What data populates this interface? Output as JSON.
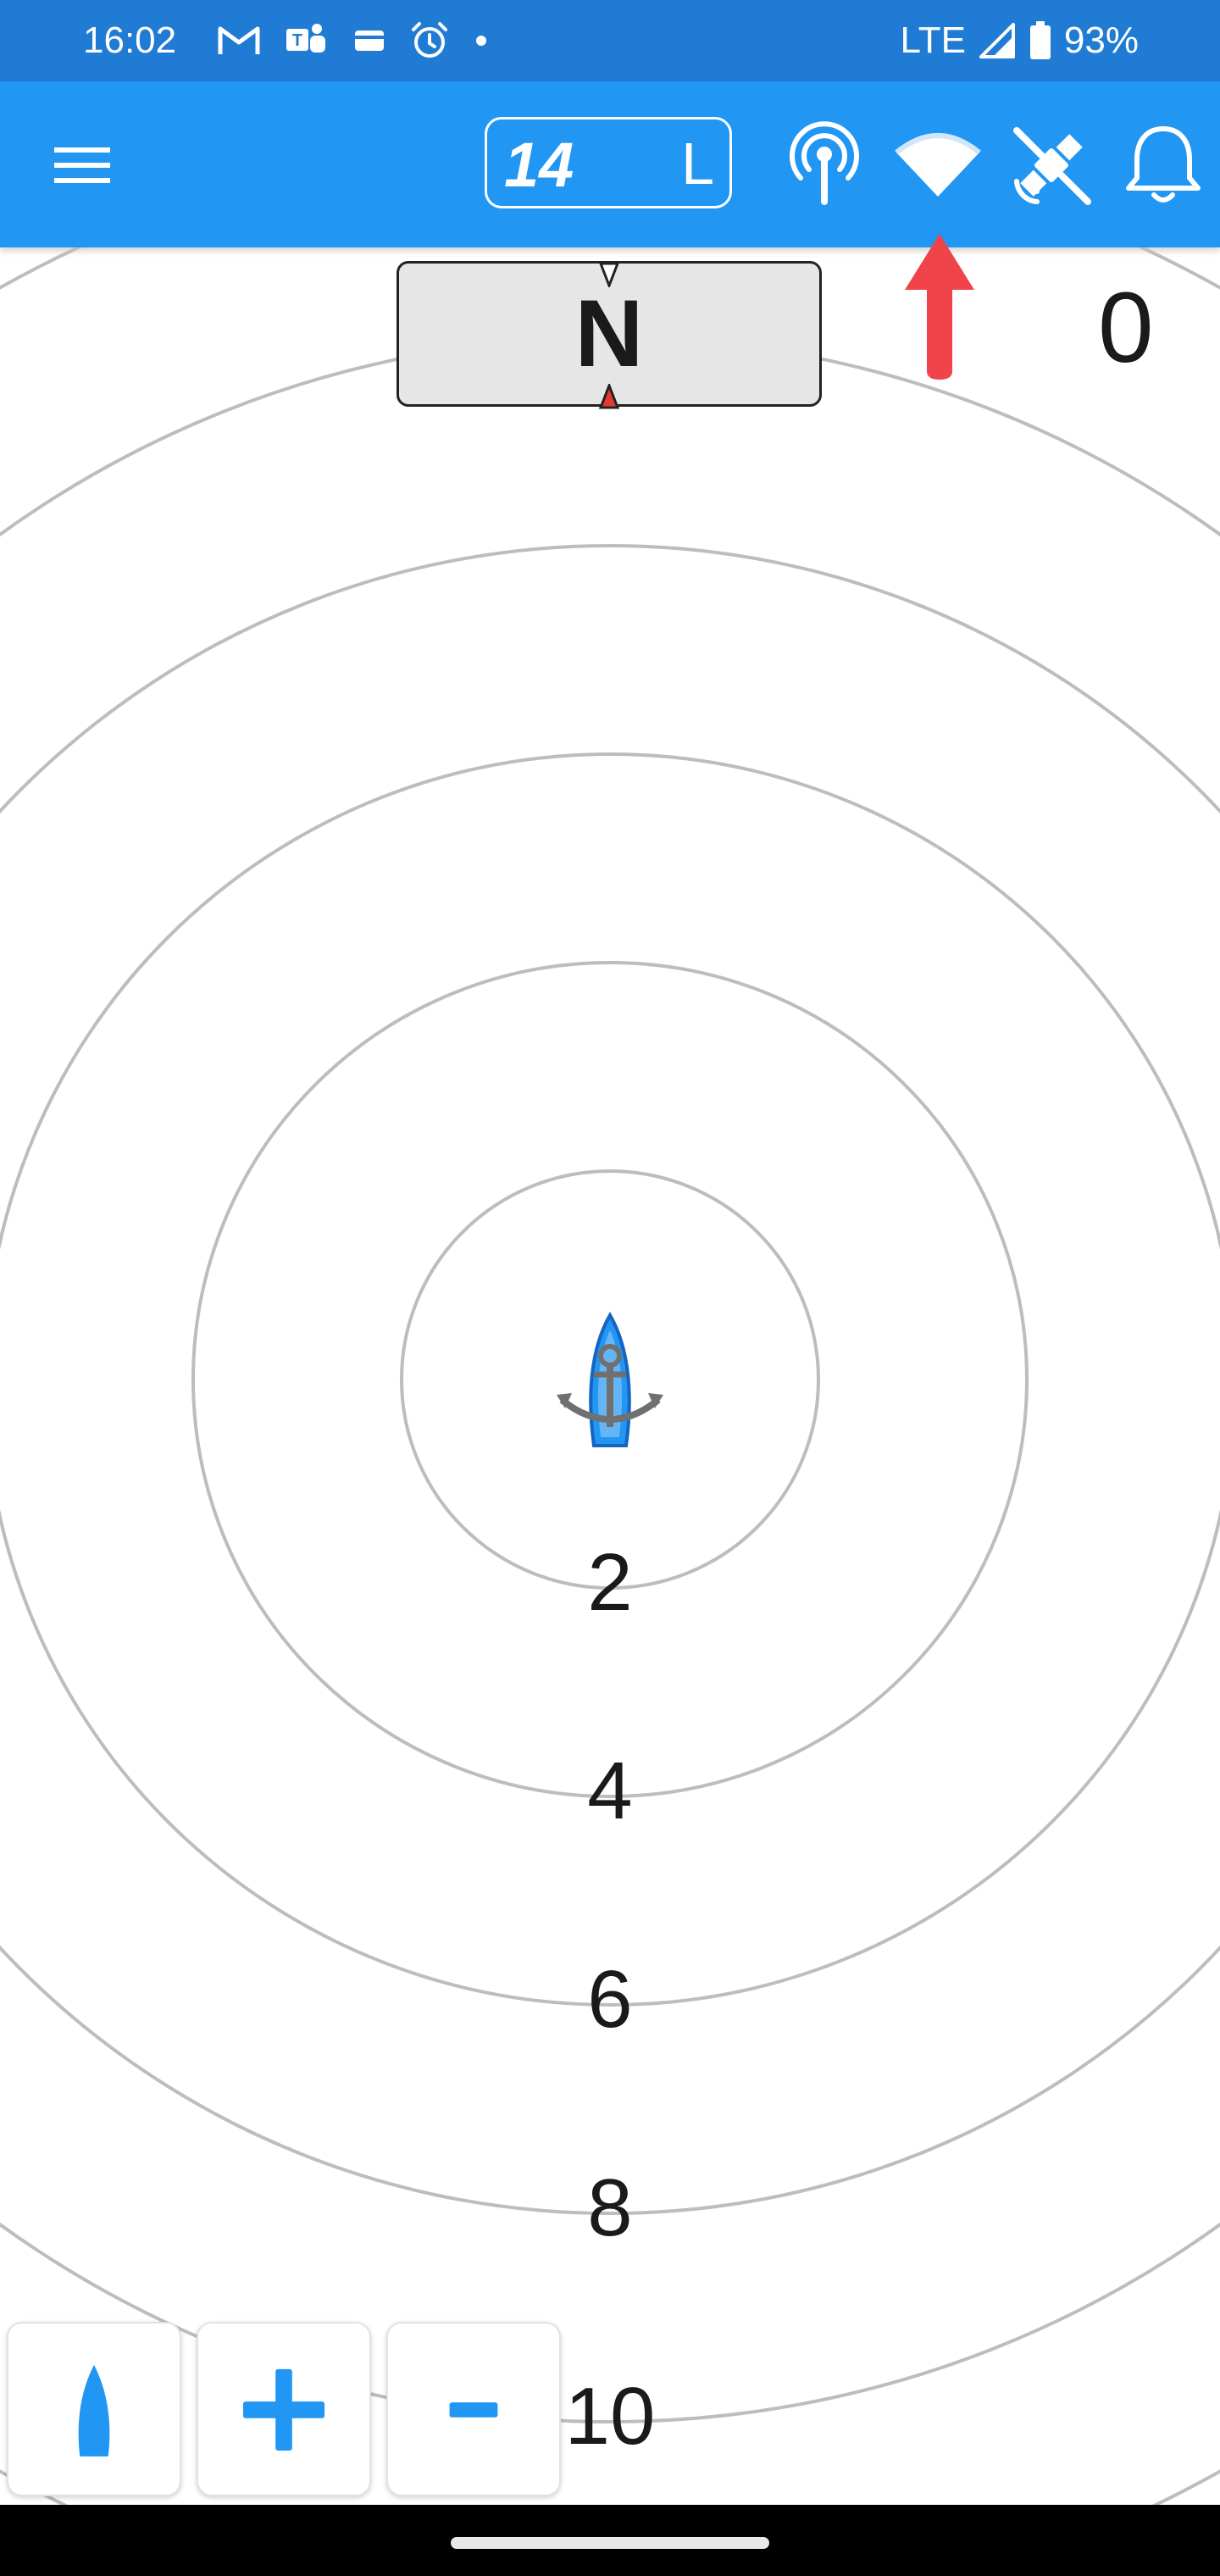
{
  "status_bar": {
    "time": "16:02",
    "network": "LTE",
    "battery": "93%",
    "left_icons": [
      "gmail-icon",
      "teams-icon",
      "wallet-icon",
      "alarm-icon",
      "dot-icon"
    ]
  },
  "app_bar": {
    "depth_value": "14",
    "depth_unit": "L",
    "icons": [
      "menu-icon",
      "antenna-icon",
      "wifi-icon",
      "gps-off-icon",
      "bell-icon"
    ]
  },
  "compass": {
    "heading_label": "N"
  },
  "counter_value": "0",
  "range_rings": {
    "labels": [
      "2",
      "4",
      "6",
      "8",
      "10"
    ]
  },
  "bottom_buttons": {
    "plus_label": "+",
    "minus_label": "-"
  },
  "colors": {
    "status_bar": "#1f7bd3",
    "app_bar": "#2196f3",
    "ring": "#bdbdbd",
    "accent": "#2196f3",
    "arrow": "#f0434a",
    "compass_bg": "#e6e6e6"
  }
}
